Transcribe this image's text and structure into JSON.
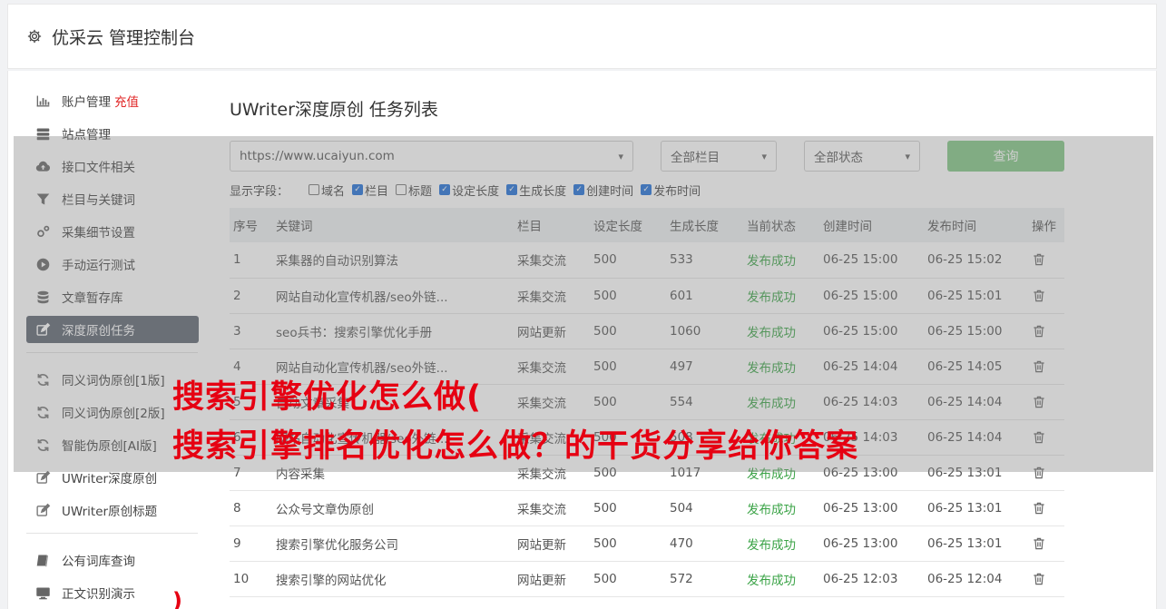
{
  "header": {
    "title": "优采云 管理控制台"
  },
  "sidebar": {
    "items": [
      {
        "label": "账户管理",
        "badge": "充值",
        "icon": "bar-chart-icon"
      },
      {
        "label": "站点管理",
        "icon": "server-icon"
      },
      {
        "label": "接口文件相关",
        "icon": "cloud-upload-icon"
      },
      {
        "label": "栏目与关键词",
        "icon": "filter-icon"
      },
      {
        "label": "采集细节设置",
        "icon": "gears-icon"
      },
      {
        "label": "手动运行测试",
        "icon": "play-circle-icon"
      },
      {
        "label": "文章暂存库",
        "icon": "database-icon"
      },
      {
        "label": "深度原创任务",
        "icon": "edit-icon",
        "active": true
      }
    ],
    "group2": [
      {
        "label": "同义词伪原创[1版]",
        "icon": "refresh-icon"
      },
      {
        "label": "同义词伪原创[2版]",
        "icon": "refresh-icon"
      },
      {
        "label": "智能伪原创[AI版]",
        "icon": "refresh-icon"
      },
      {
        "label": "UWriter深度原创",
        "icon": "edit-icon"
      },
      {
        "label": "UWriter原创标题",
        "icon": "edit-icon"
      }
    ],
    "group3": [
      {
        "label": "公有词库查询",
        "icon": "book-icon"
      },
      {
        "label": "正文识别演示",
        "icon": "monitor-icon"
      }
    ]
  },
  "main": {
    "title": "UWriter深度原创 任务列表",
    "filters": {
      "site": "https://www.ucaiyun.com",
      "column": "全部栏目",
      "status": "全部状态",
      "query_label": "查询"
    },
    "fields": {
      "label": "显示字段：",
      "options": [
        {
          "label": "域名",
          "checked": false
        },
        {
          "label": "栏目",
          "checked": true
        },
        {
          "label": "标题",
          "checked": false
        },
        {
          "label": "设定长度",
          "checked": true
        },
        {
          "label": "生成长度",
          "checked": true
        },
        {
          "label": "创建时间",
          "checked": true
        },
        {
          "label": "发布时间",
          "checked": true
        }
      ]
    },
    "table": {
      "headers": [
        "序号",
        "关键词",
        "栏目",
        "设定长度",
        "生成长度",
        "当前状态",
        "创建时间",
        "发布时间",
        "操作"
      ],
      "rows": [
        [
          "1",
          "采集器的自动识别算法",
          "采集交流",
          "500",
          "533",
          "发布成功",
          "06-25 15:00",
          "06-25 15:02"
        ],
        [
          "2",
          "网站自动化宣传机器/seo外链...",
          "采集交流",
          "500",
          "601",
          "发布成功",
          "06-25 15:00",
          "06-25 15:01"
        ],
        [
          "3",
          "seo兵书：搜索引擎优化手册",
          "网站更新",
          "500",
          "1060",
          "发布成功",
          "06-25 15:00",
          "06-25 15:00"
        ],
        [
          "4",
          "网站自动化宣传机器/seo外链...",
          "采集交流",
          "500",
          "497",
          "发布成功",
          "06-25 14:04",
          "06-25 14:05"
        ],
        [
          "5",
          "自动文章采集",
          "采集交流",
          "500",
          "554",
          "发布成功",
          "06-25 14:03",
          "06-25 14:04"
        ],
        [
          "6",
          "网站自动化宣传机器/seo外链...",
          "采集交流",
          "500",
          "508",
          "发布成功",
          "06-25 14:03",
          "06-25 14:04"
        ],
        [
          "7",
          "内容采集",
          "采集交流",
          "500",
          "1017",
          "发布成功",
          "06-25 13:00",
          "06-25 13:01"
        ],
        [
          "8",
          "公众号文章伪原创",
          "采集交流",
          "500",
          "504",
          "发布成功",
          "06-25 13:00",
          "06-25 13:01"
        ],
        [
          "9",
          "搜索引擎优化服务公司",
          "网站更新",
          "500",
          "470",
          "发布成功",
          "06-25 13:00",
          "06-25 13:01"
        ],
        [
          "10",
          "搜索引擎的网站优化",
          "网站更新",
          "500",
          "572",
          "发布成功",
          "06-25 12:03",
          "06-25 12:04"
        ]
      ]
    }
  },
  "overlay": {
    "line1": "搜索引擎优化怎么做(",
    "line2": "搜索引擎排名优化怎么做？的干货分享给你答案",
    "tail": ")"
  },
  "colors": {
    "active_nav": "#5d6470",
    "query_button": "#82c785",
    "success": "#3aa346",
    "headline": "#e60012",
    "recharge": "#e02424"
  }
}
